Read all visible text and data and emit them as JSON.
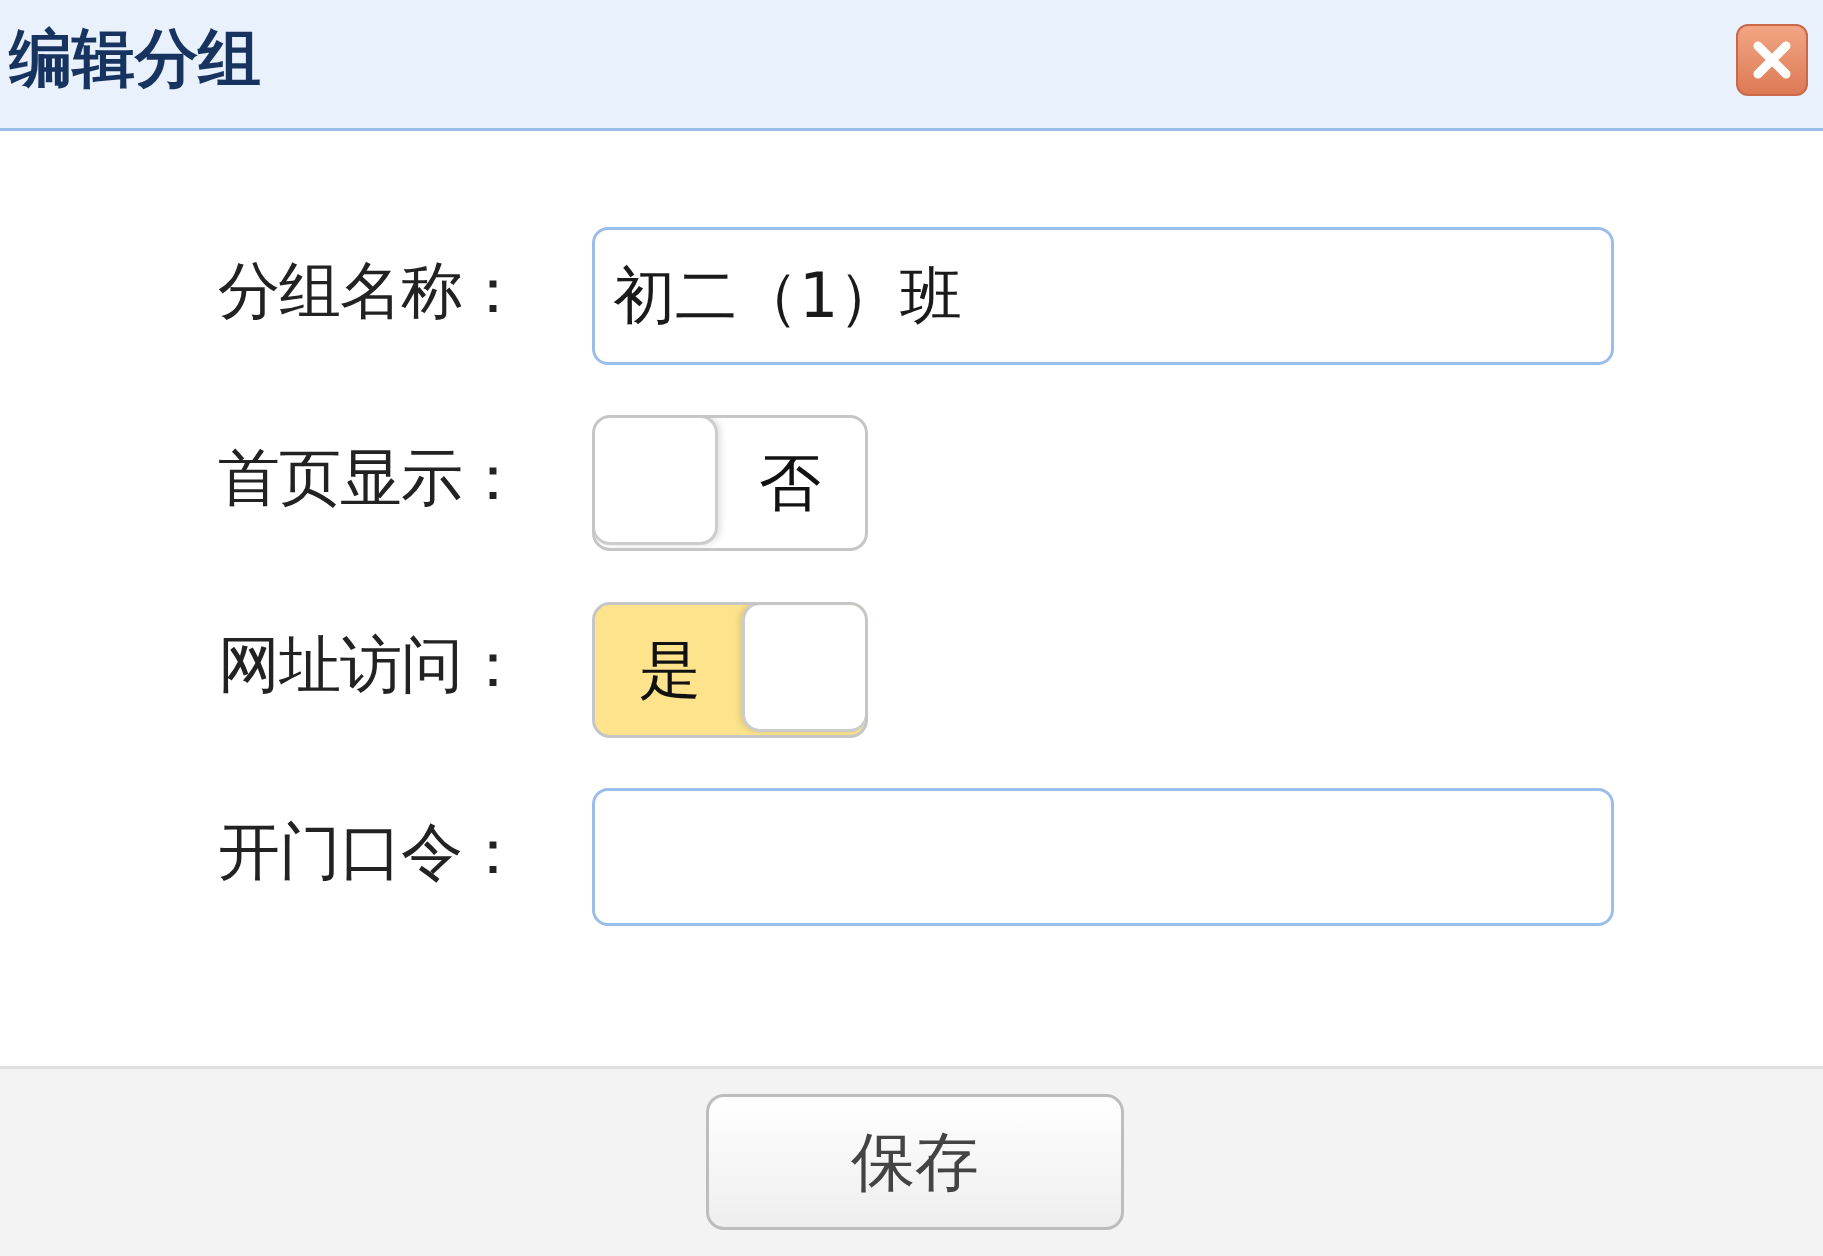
{
  "dialog": {
    "title": "编辑分组"
  },
  "fields": [
    {
      "kind": "text",
      "label": "分组名称：",
      "value": "初二（1）班"
    },
    {
      "kind": "toggle",
      "label": "首页显示：",
      "on": false,
      "state_text": "否"
    },
    {
      "kind": "toggle",
      "label": "网址访问：",
      "on": true,
      "state_text": "是"
    },
    {
      "kind": "text",
      "label": "开门口令："
    }
  ],
  "footer": {
    "buttons": [
      {
        "label": "保存"
      }
    ]
  }
}
